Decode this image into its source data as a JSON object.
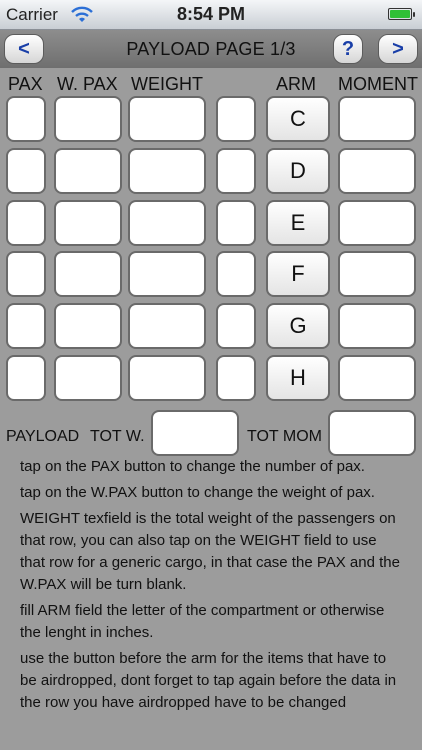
{
  "status_bar": {
    "carrier": "Carrier",
    "time": "8:54 PM"
  },
  "nav": {
    "back": "<",
    "title": "PAYLOAD PAGE 1/3",
    "help": "?",
    "next": ">"
  },
  "headers": {
    "pax": "PAX",
    "wpax": "W. PAX",
    "weight": "WEIGHT",
    "arm": "ARM",
    "moment": "MOMENT"
  },
  "rows": [
    {
      "arm": "C"
    },
    {
      "arm": "D"
    },
    {
      "arm": "E"
    },
    {
      "arm": "F"
    },
    {
      "arm": "G"
    },
    {
      "arm": "H"
    }
  ],
  "totals": {
    "payload_label": "PAYLOAD",
    "tot_w_label": "TOT W.",
    "tot_mom_label": "TOT MOM"
  },
  "help": [
    "tap on the PAX button to change the number of pax.",
    "tap on the W.PAX button to change the weight of pax.",
    "WEIGHT texfield is the total weight of the passengers on that row, you can also tap on the WEIGHT field to use that row for a generic cargo, in that case the PAX and the W.PAX will be turn blank.",
    "fill ARM field the letter of the compartment or otherwise the lenght in inches.",
    "use the button before the arm for the items that have to be airdropped, dont forget to tap again before the data in the row you have airdropped have to be changed"
  ]
}
